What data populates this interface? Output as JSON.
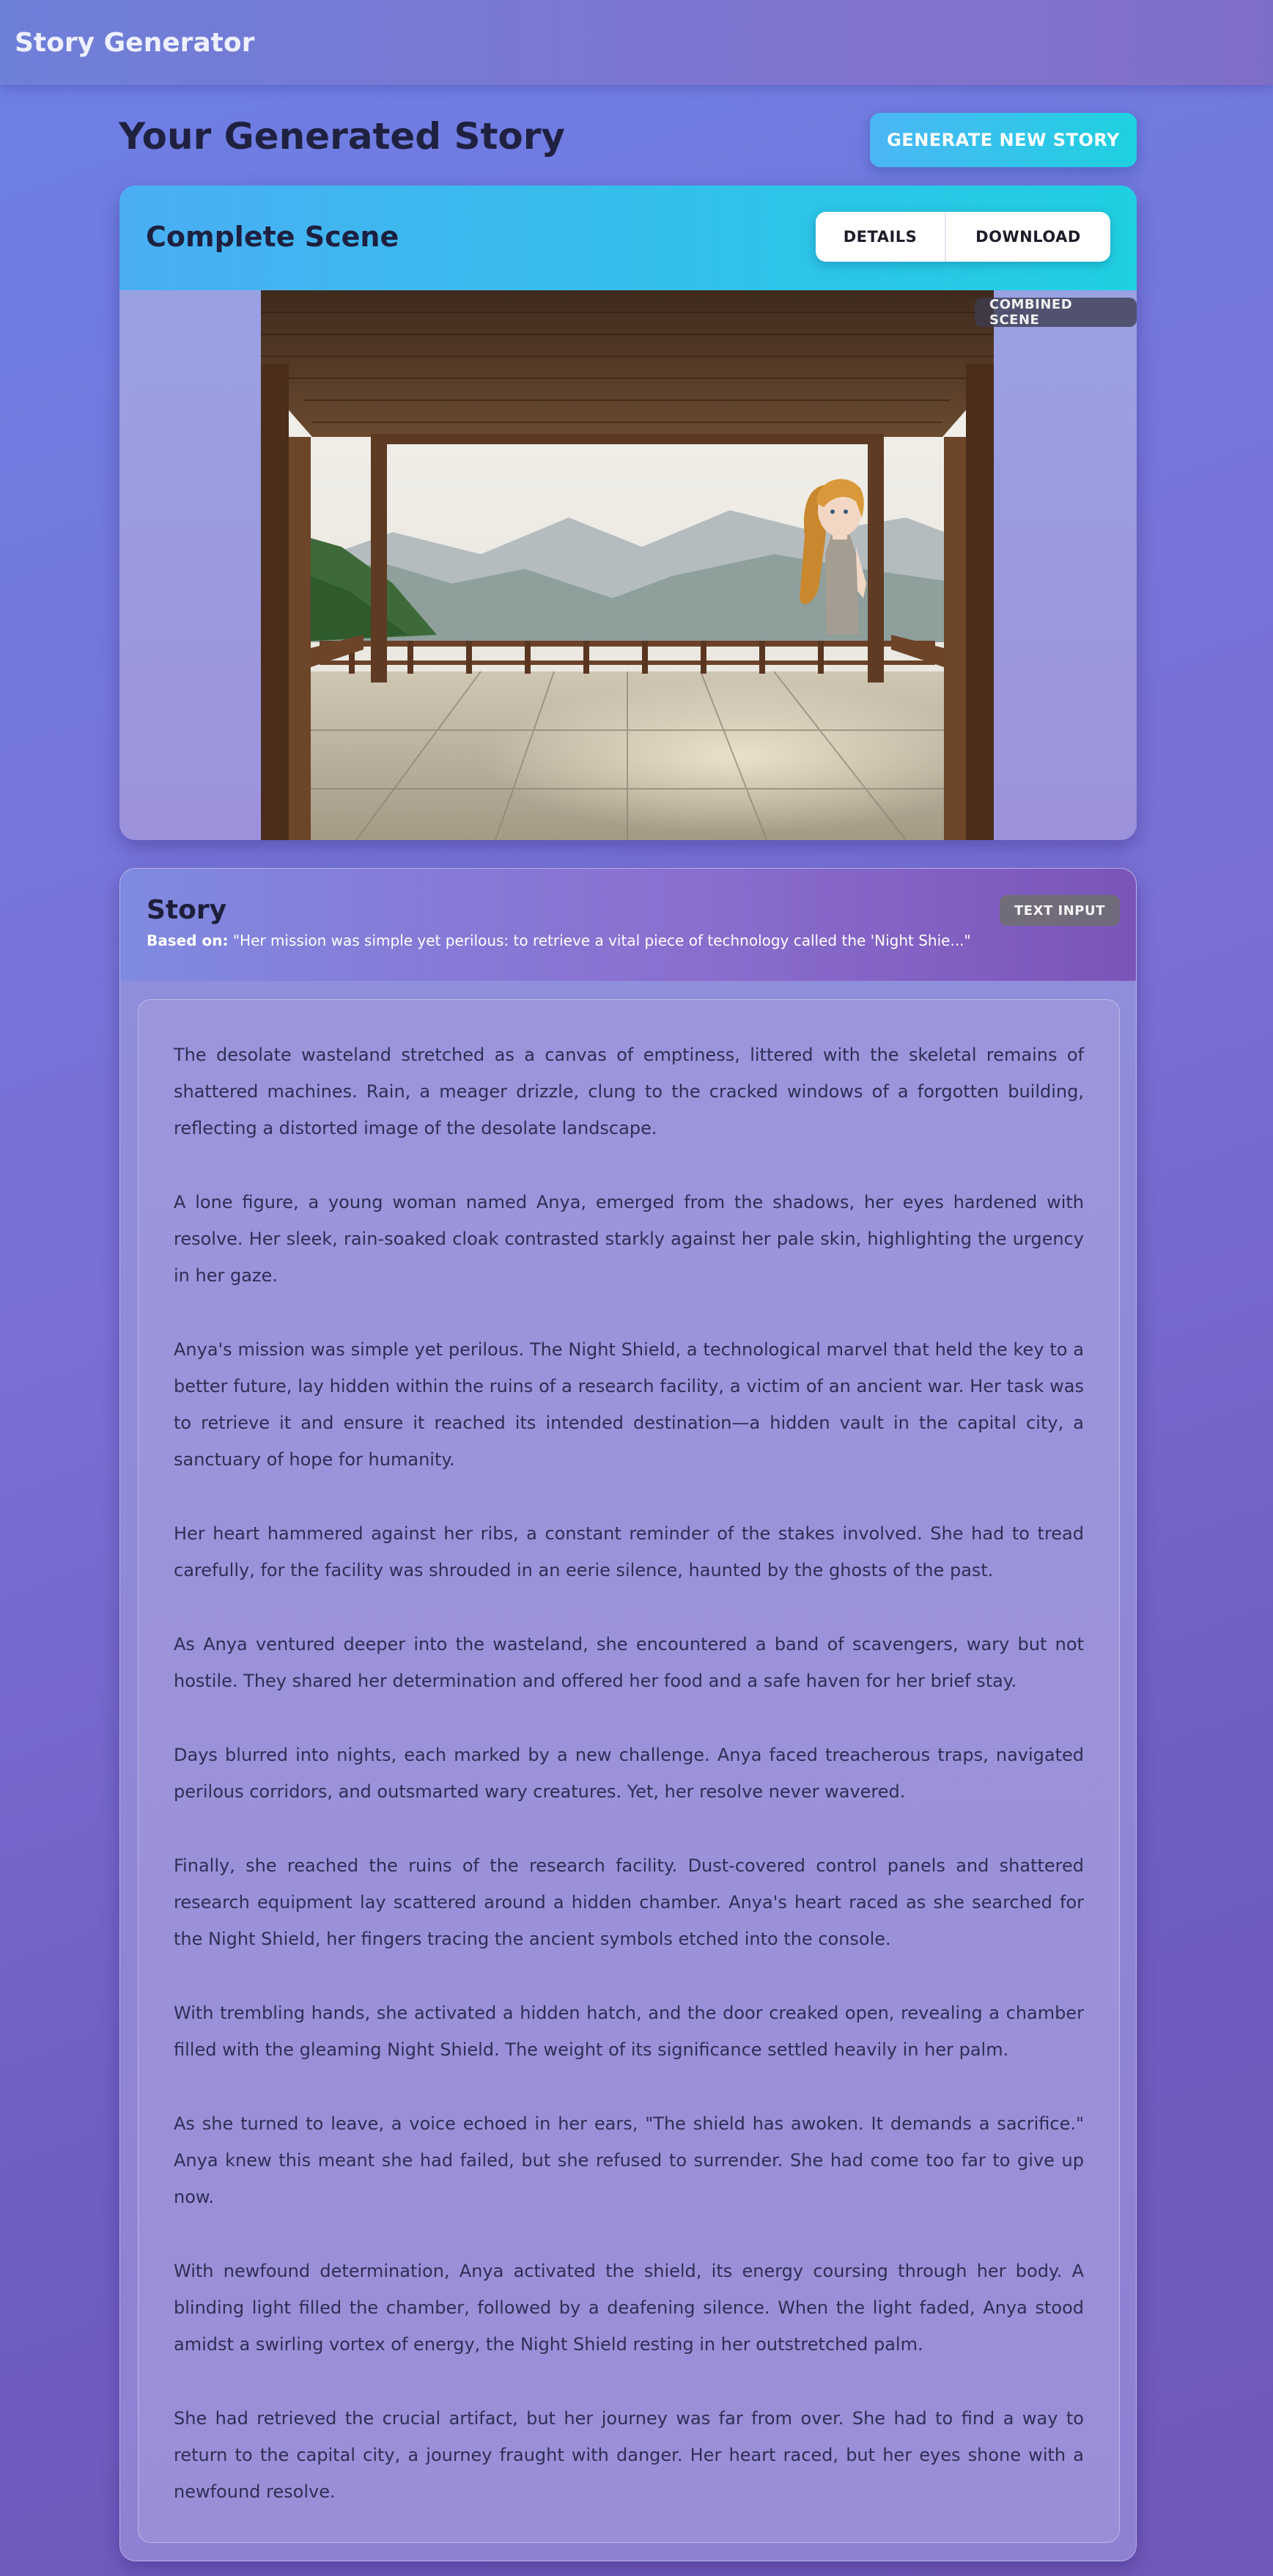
{
  "app": {
    "title": "Story Generator"
  },
  "page": {
    "title": "Your Generated Story",
    "generate_button": "GENERATE NEW STORY"
  },
  "scene": {
    "title": "Complete Scene",
    "details_button": "DETAILS",
    "download_button": "DOWNLOAD",
    "badge": "COMBINED SCENE"
  },
  "story": {
    "title": "Story",
    "badge": "TEXT INPUT",
    "based_on_label": "Based on:",
    "based_on_text": "\"Her mission was simple yet perilous: to retrieve a vital piece of technology called the 'Night Shie...\"",
    "paragraphs": [
      "The desolate wasteland stretched as a canvas of emptiness, littered with the skeletal remains of shattered machines. Rain, a meager drizzle, clung to the cracked windows of a forgotten building, reflecting a distorted image of the desolate landscape.",
      "A lone figure, a young woman named Anya, emerged from the shadows, her eyes hardened with resolve. Her sleek, rain-soaked cloak contrasted starkly against her pale skin, highlighting the urgency in her gaze.",
      "Anya's mission was simple yet perilous. The Night Shield, a technological marvel that held the key to a better future, lay hidden within the ruins of a research facility, a victim of an ancient war. Her task was to retrieve it and ensure it reached its intended destination—a hidden vault in the capital city, a sanctuary of hope for humanity.",
      "Her heart hammered against her ribs, a constant reminder of the stakes involved. She had to tread carefully, for the facility was shrouded in an eerie silence, haunted by the ghosts of the past.",
      "As Anya ventured deeper into the wasteland, she encountered a band of scavengers, wary but not hostile. They shared her determination and offered her food and a safe haven for her brief stay.",
      "Days blurred into nights, each marked by a new challenge. Anya faced treacherous traps, navigated perilous corridors, and outsmarted wary creatures. Yet, her resolve never wavered.",
      "Finally, she reached the ruins of the research facility. Dust-covered control panels and shattered research equipment lay scattered around a hidden chamber. Anya's heart raced as she searched for the Night Shield, her fingers tracing the ancient symbols etched into the console.",
      "With trembling hands, she activated a hidden hatch, and the door creaked open, revealing a chamber filled with the gleaming Night Shield. The weight of its significance settled heavily in her palm.",
      "As she turned to leave, a voice echoed in her ears, \"The shield has awoken. It demands a sacrifice.\" Anya knew this meant she had failed, but she refused to surrender. She had come too far to give up now.",
      "With newfound determination, Anya activated the shield, its energy coursing through her body. A blinding light filled the chamber, followed by a deafening silence. When the light faded, Anya stood amidst a swirling vortex of energy, the Night Shield resting in her outstretched palm.",
      "She had retrieved the crucial artifact, but her journey was far from over. She had to find a way to return to the capital city, a journey fraught with danger. Her heart raced, but her eyes shone with a newfound resolve."
    ]
  },
  "colors": {
    "accent_gradient_start": "#4cb6f5",
    "accent_gradient_end": "#1ed1e0",
    "background": "#7a6fd4",
    "title_text": "#1f2140"
  }
}
